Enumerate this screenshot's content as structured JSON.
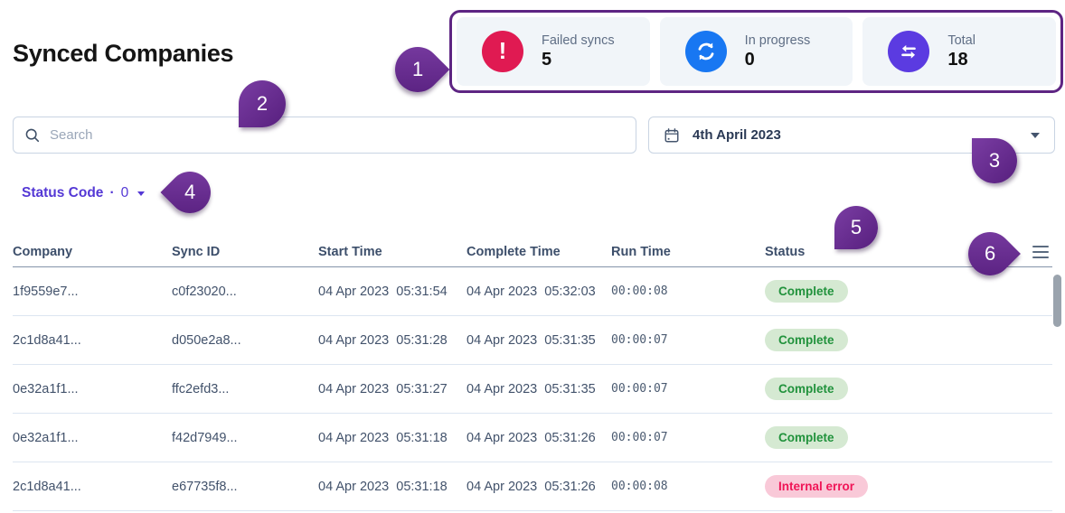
{
  "page": {
    "title": "Synced Companies"
  },
  "stats": {
    "cards": [
      {
        "label": "Failed syncs",
        "value": "5",
        "icon": "alert-icon",
        "color": "#e01a52"
      },
      {
        "label": "In progress",
        "value": "0",
        "icon": "refresh-icon",
        "color": "#1877f2"
      },
      {
        "label": "Total",
        "value": "18",
        "icon": "transfer-arrows-icon",
        "color": "#5b3be1"
      }
    ]
  },
  "search": {
    "placeholder": "Search"
  },
  "date_picker": {
    "value": "4th April 2023"
  },
  "status_filter": {
    "label": "Status Code",
    "separator": "·",
    "count": "0"
  },
  "table": {
    "columns": [
      "Company",
      "Sync ID",
      "Start Time",
      "Complete Time",
      "Run Time",
      "Status"
    ],
    "rows": [
      {
        "company": "1f9559e7...",
        "sync_id": "c0f23020...",
        "start_time": "04 Apr 2023  05:31:54",
        "complete_time": "04 Apr 2023  05:32:03",
        "run_time": "00:00:08",
        "status": "Complete",
        "status_type": "success"
      },
      {
        "company": "2c1d8a41...",
        "sync_id": "d050e2a8...",
        "start_time": "04 Apr 2023  05:31:28",
        "complete_time": "04 Apr 2023  05:31:35",
        "run_time": "00:00:07",
        "status": "Complete",
        "status_type": "success"
      },
      {
        "company": "0e32a1f1...",
        "sync_id": "ffc2efd3...",
        "start_time": "04 Apr 2023  05:31:27",
        "complete_time": "04 Apr 2023  05:31:35",
        "run_time": "00:00:07",
        "status": "Complete",
        "status_type": "success"
      },
      {
        "company": "0e32a1f1...",
        "sync_id": "f42d7949...",
        "start_time": "04 Apr 2023  05:31:18",
        "complete_time": "04 Apr 2023  05:31:26",
        "run_time": "00:00:07",
        "status": "Complete",
        "status_type": "success"
      },
      {
        "company": "2c1d8a41...",
        "sync_id": "e67735f8...",
        "start_time": "04 Apr 2023  05:31:18",
        "complete_time": "04 Apr 2023  05:31:26",
        "run_time": "00:00:08",
        "status": "Internal error",
        "status_type": "error"
      }
    ]
  },
  "annotations": {
    "markers": [
      "1",
      "2",
      "3",
      "4",
      "5",
      "6"
    ]
  },
  "colors": {
    "annotation_purple": "#5e2583",
    "failed_icon": "#e01a52",
    "progress_icon": "#1877f2",
    "total_icon": "#5b3be1",
    "badge_success_bg": "#d5e9d2",
    "badge_success_text": "#21923c",
    "badge_error_bg": "#f9c9d8",
    "badge_error_text": "#f01557",
    "filter_accent": "#5438d5"
  }
}
